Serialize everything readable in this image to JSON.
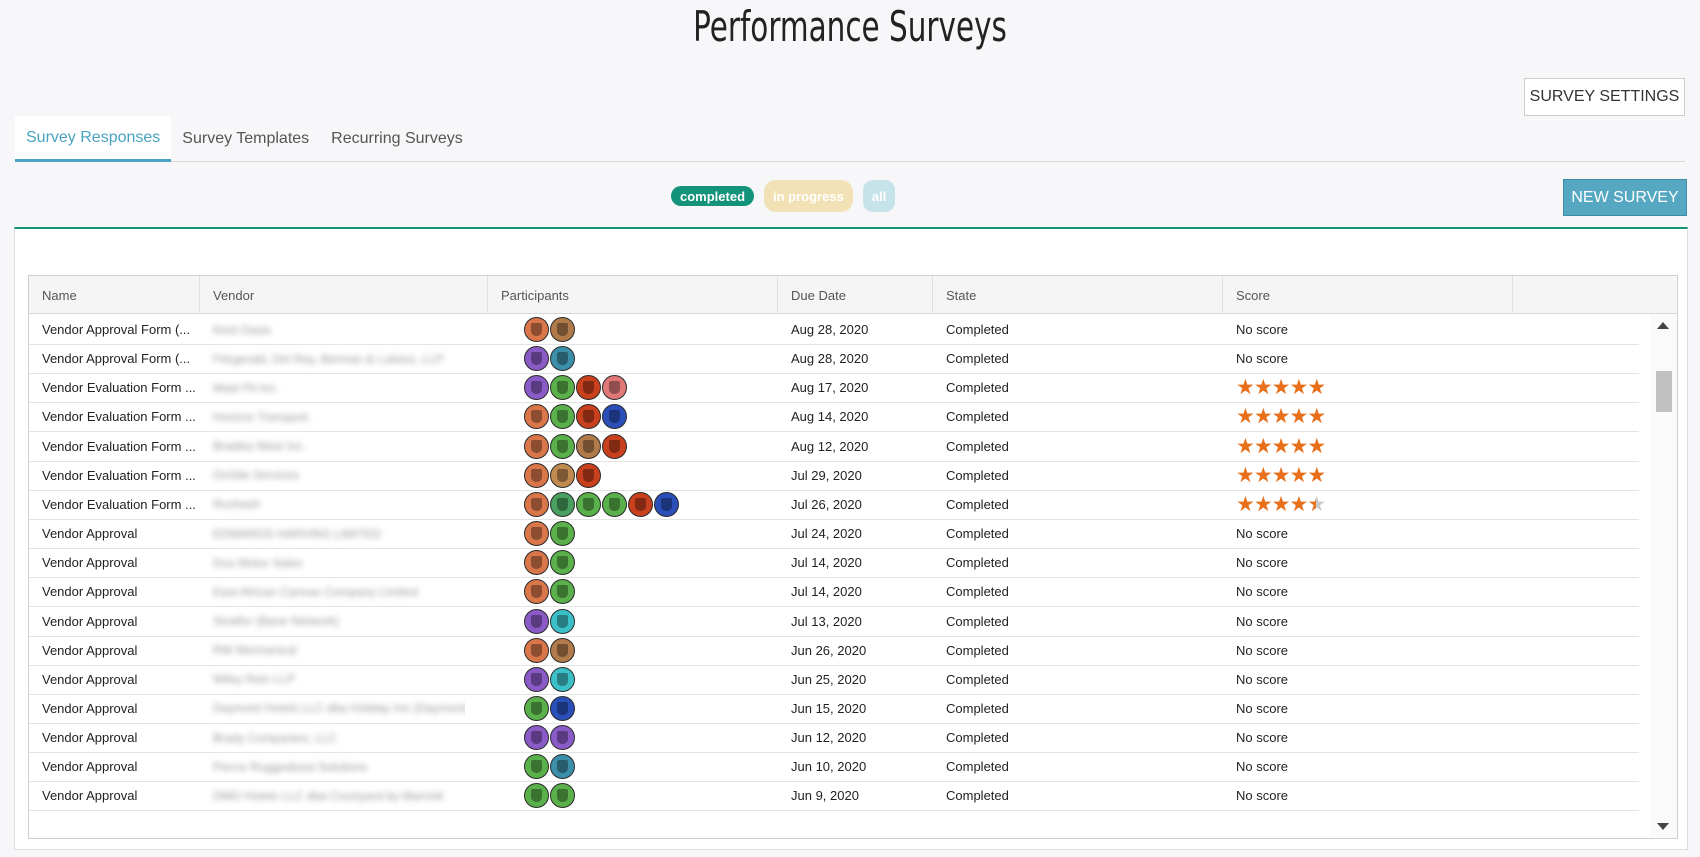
{
  "page_title": "Performance Surveys",
  "settings_button": "SURVEY SETTINGS",
  "new_survey_button": "NEW SURVEY",
  "tabs": [
    {
      "label": "Survey Responses",
      "active": true
    },
    {
      "label": "Survey Templates",
      "active": false
    },
    {
      "label": "Recurring Surveys",
      "active": false
    }
  ],
  "filters": {
    "completed": "completed",
    "in_progress": "in progress",
    "all": "all"
  },
  "columns": {
    "name": "Name",
    "vendor": "Vendor",
    "participants": "Participants",
    "due_date": "Due Date",
    "state": "State",
    "score": "Score"
  },
  "colors": {
    "accent": "#4aa3c2",
    "completed": "#12937a",
    "in_progress": "#f2e1b5",
    "all": "#c6e3ea",
    "star": "#e8701a"
  },
  "rows": [
    {
      "name": "Vendor Approval Form (...",
      "vendor": "Kind Oasis",
      "avatars": [
        "#d9774a",
        "#b07a4a"
      ],
      "due": "Aug 28, 2020",
      "state": "Completed",
      "score_text": "No score",
      "stars": null
    },
    {
      "name": "Vendor Approval Form (...",
      "vendor": "Fitzgerald, Del Rey, Berman & Lukasz, LLP",
      "avatars": [
        "#8a5bc7",
        "#3c8fa8"
      ],
      "due": "Aug 28, 2020",
      "state": "Completed",
      "score_text": "No score",
      "stars": null
    },
    {
      "name": "Vendor Evaluation Form ...",
      "vendor": "Mast Pit Inc.",
      "avatars": [
        "#8a5bc7",
        "#5ab04a",
        "#c8401e",
        "#e07878"
      ],
      "due": "Aug 17, 2020",
      "state": "Completed",
      "score_text": "",
      "stars": 4.9
    },
    {
      "name": "Vendor Evaluation Form ...",
      "vendor": "Horizon Transport",
      "avatars": [
        "#d9774a",
        "#5ab04a",
        "#c8401e",
        "#2a4fb8"
      ],
      "due": "Aug 14, 2020",
      "state": "Completed",
      "score_text": "",
      "stars": 4.9
    },
    {
      "name": "Vendor Evaluation Form ...",
      "vendor": "Bradley Mast Inc.",
      "avatars": [
        "#d9774a",
        "#5ab04a",
        "#b07a4a",
        "#c8401e"
      ],
      "due": "Aug 12, 2020",
      "state": "Completed",
      "score_text": "",
      "stars": 5
    },
    {
      "name": "Vendor Evaluation Form ...",
      "vendor": "OnSite Services",
      "avatars": [
        "#d9774a",
        "#c08a50",
        "#c8401e"
      ],
      "due": "Jul 29, 2020",
      "state": "Completed",
      "score_text": "",
      "stars": 4.9
    },
    {
      "name": "Vendor Evaluation Form ...",
      "vendor": "Rushash",
      "avatars": [
        "#d9774a",
        "#4aa060",
        "#5ab04a",
        "#5ab04a",
        "#c8401e",
        "#2a4fb8"
      ],
      "due": "Jul 26, 2020",
      "state": "Completed",
      "score_text": "",
      "stars": 4.5
    },
    {
      "name": "Vendor Approval",
      "vendor": "EDWARDS HARVINS LIMITED",
      "avatars": [
        "#d9774a",
        "#5ab04a"
      ],
      "due": "Jul 24, 2020",
      "state": "Completed",
      "score_text": "No score",
      "stars": null
    },
    {
      "name": "Vendor Approval",
      "vendor": "Duo Motor Sales",
      "avatars": [
        "#d9774a",
        "#5ab04a"
      ],
      "due": "Jul 14, 2020",
      "state": "Completed",
      "score_text": "No score",
      "stars": null
    },
    {
      "name": "Vendor Approval",
      "vendor": "East African Canvas Company Limited",
      "avatars": [
        "#d9774a",
        "#5ab04a"
      ],
      "due": "Jul 14, 2020",
      "state": "Completed",
      "score_text": "No score",
      "stars": null
    },
    {
      "name": "Vendor Approval",
      "vendor": "Stratfor (Bane Network)",
      "avatars": [
        "#8a5bc7",
        "#3cc0c8"
      ],
      "due": "Jul 13, 2020",
      "state": "Completed",
      "score_text": "No score",
      "stars": null
    },
    {
      "name": "Vendor Approval",
      "vendor": "RW Mechanical",
      "avatars": [
        "#d9774a",
        "#b07a4a"
      ],
      "due": "Jun 26, 2020",
      "state": "Completed",
      "score_text": "No score",
      "stars": null
    },
    {
      "name": "Vendor Approval",
      "vendor": "Wiley Rein LLP",
      "avatars": [
        "#8a5bc7",
        "#3cc0c8"
      ],
      "due": "Jun 25, 2020",
      "state": "Completed",
      "score_text": "No score",
      "stars": null
    },
    {
      "name": "Vendor Approval",
      "vendor": "Daymont Hotels LLC dba Holiday Inn (Daymont)",
      "avatars": [
        "#5ab04a",
        "#2a4fb8"
      ],
      "due": "Jun 15, 2020",
      "state": "Completed",
      "score_text": "No score",
      "stars": null
    },
    {
      "name": "Vendor Approval",
      "vendor": "Brady Companies, LLC",
      "avatars": [
        "#8a5bc7",
        "#8a5bc7"
      ],
      "due": "Jun 12, 2020",
      "state": "Completed",
      "score_text": "No score",
      "stars": null
    },
    {
      "name": "Vendor Approval",
      "vendor": "Pierce Ruggedized Solutions",
      "avatars": [
        "#5ab04a",
        "#3c8fa8"
      ],
      "due": "Jun 10, 2020",
      "state": "Completed",
      "score_text": "No score",
      "stars": null
    },
    {
      "name": "Vendor Approval",
      "vendor": "DMO Hotels LLC dba Courtyard by Marriott",
      "avatars": [
        "#5ab04a",
        "#5ab04a"
      ],
      "due": "Jun 9, 2020",
      "state": "Completed",
      "score_text": "No score",
      "stars": null
    }
  ]
}
